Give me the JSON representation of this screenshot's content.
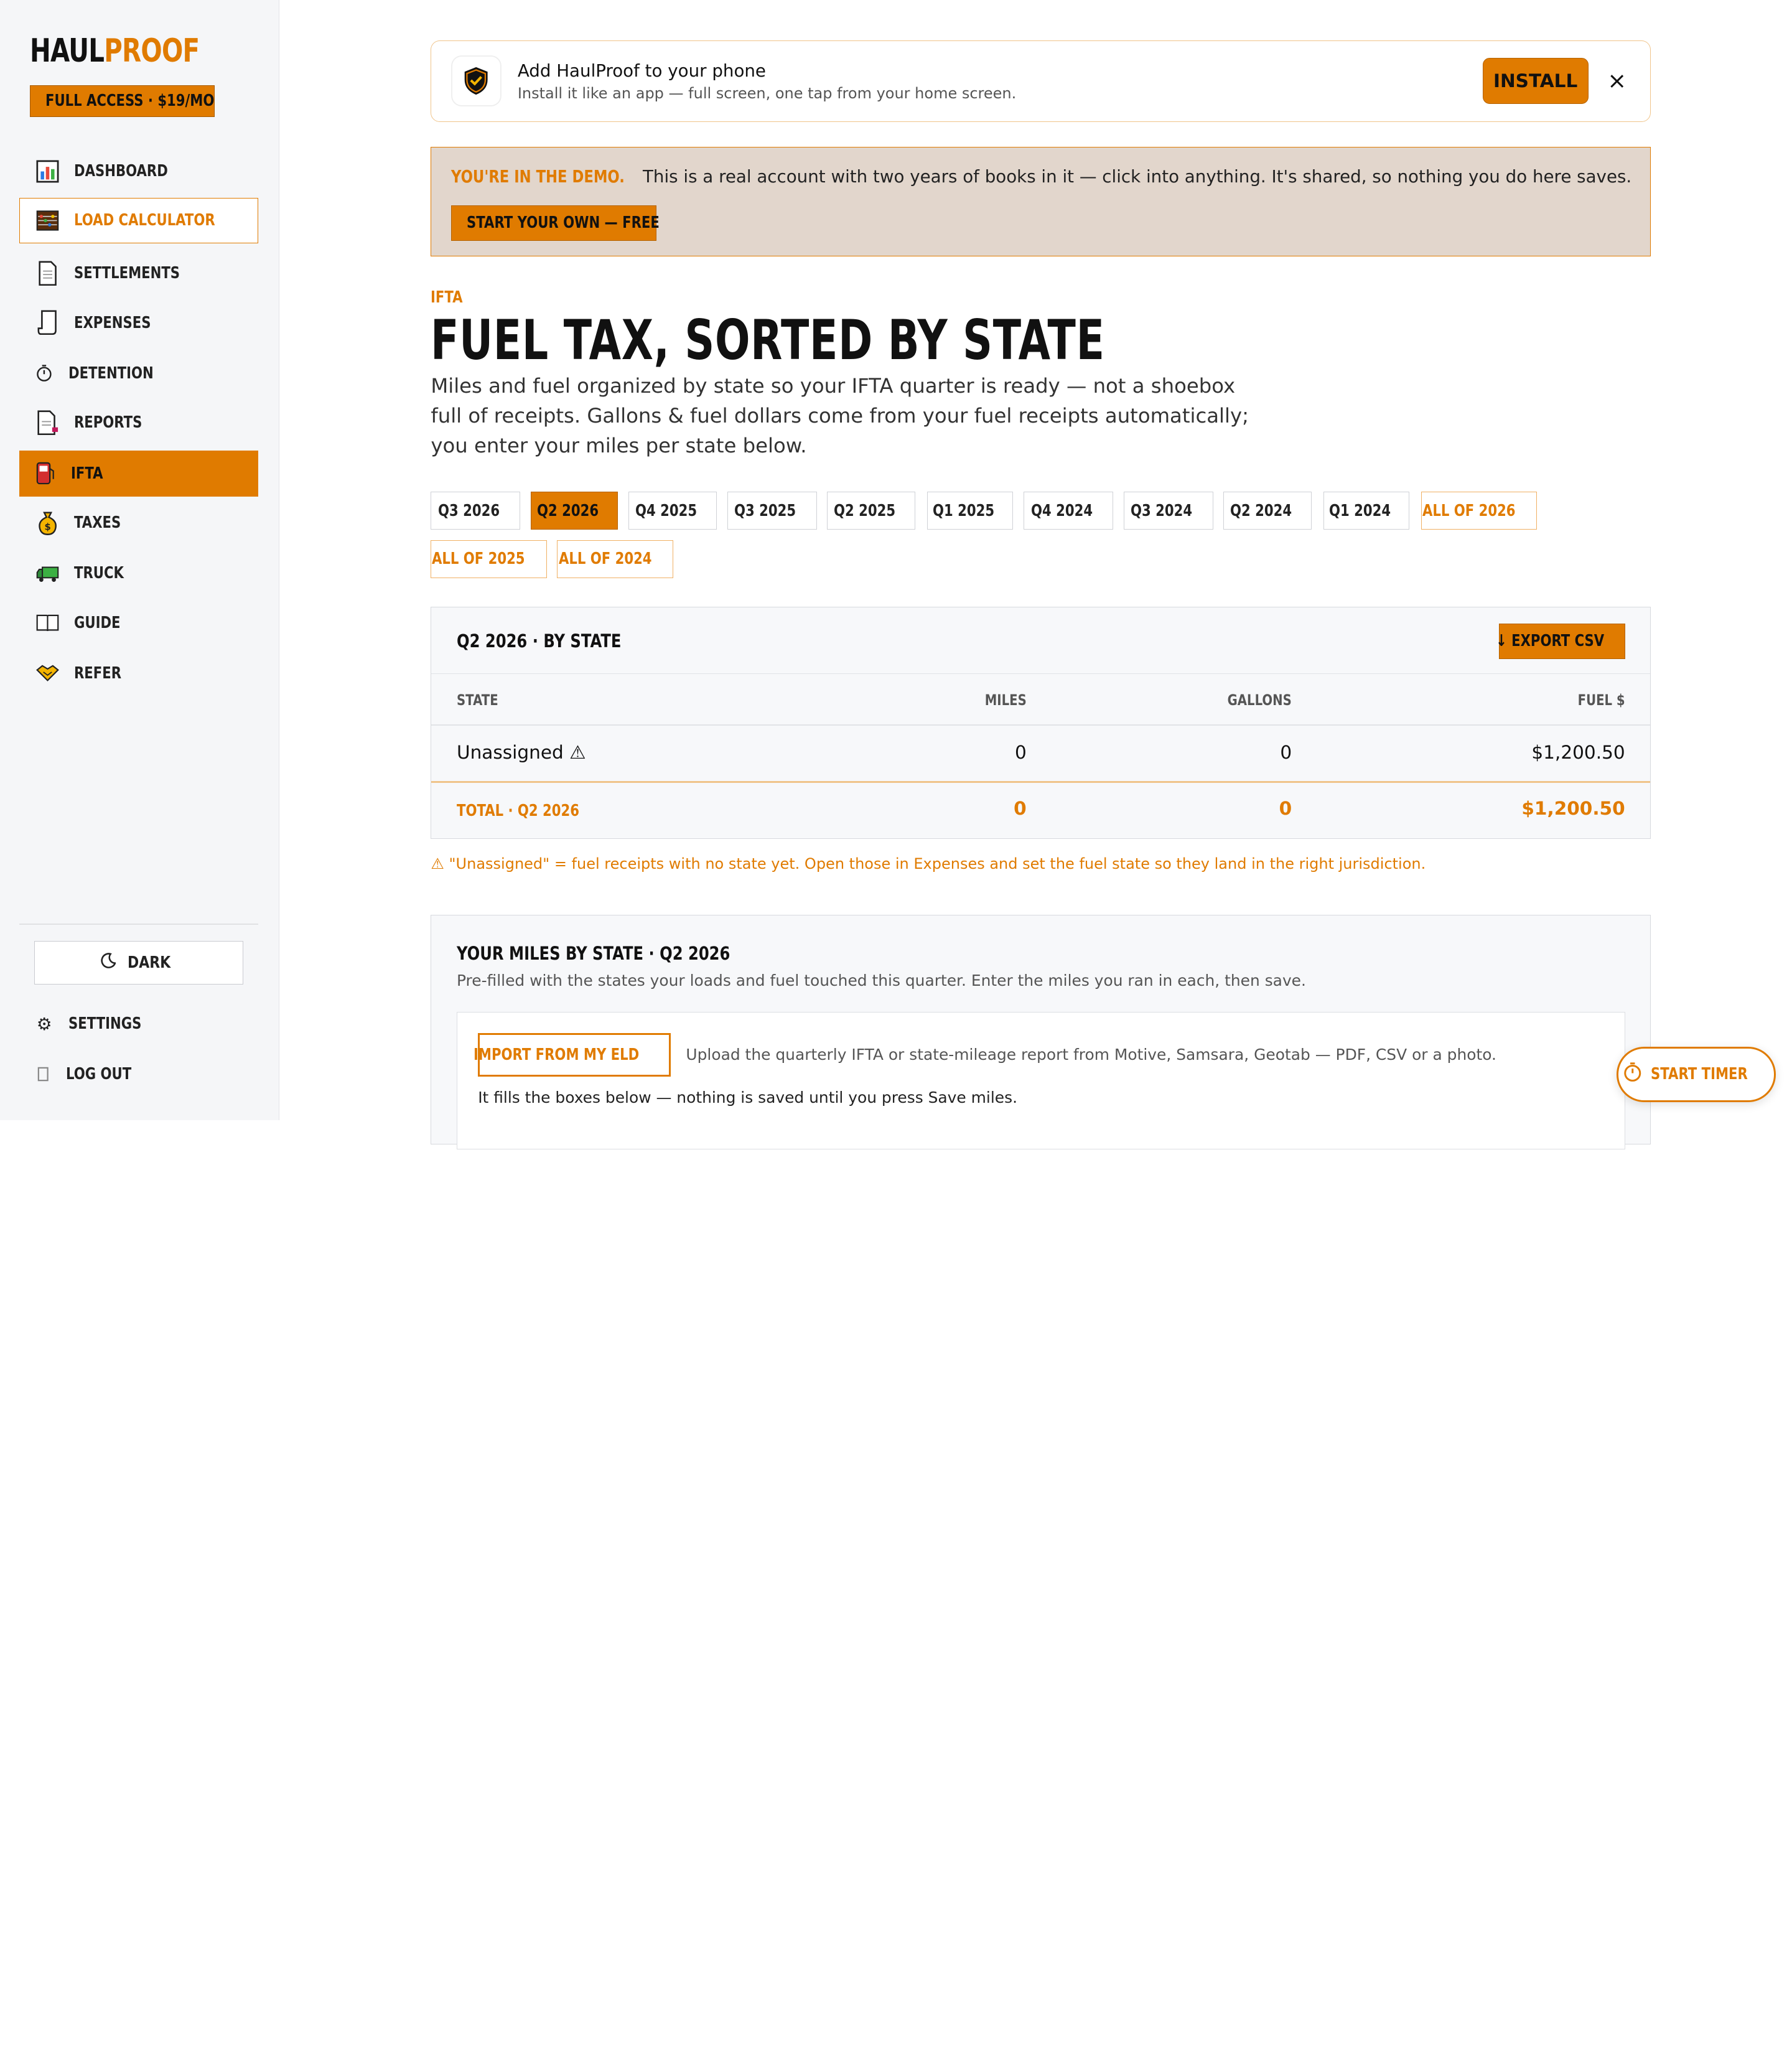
{
  "brand": {
    "part1": "HAUL",
    "part2": "PROOF"
  },
  "access_badge": "FULL ACCESS · $19/MO",
  "nav": {
    "items": [
      {
        "label": "DASHBOARD",
        "icon": "bar-chart-icon"
      },
      {
        "label": "LOAD CALCULATOR",
        "icon": "abacus-icon"
      },
      {
        "label": "SETTLEMENTS",
        "icon": "document-icon"
      },
      {
        "label": "EXPENSES",
        "icon": "receipt-icon"
      },
      {
        "label": "DETENTION",
        "icon": "stopwatch-icon"
      },
      {
        "label": "REPORTS",
        "icon": "report-icon"
      },
      {
        "label": "IFTA",
        "icon": "fuel-pump-icon"
      },
      {
        "label": "TAXES",
        "icon": "money-bag-icon"
      },
      {
        "label": "TRUCK",
        "icon": "truck-icon"
      },
      {
        "label": "GUIDE",
        "icon": "book-icon"
      },
      {
        "label": "REFER",
        "icon": "handshake-icon"
      }
    ],
    "dark_label": "DARK",
    "settings_label": "SETTINGS",
    "logout_label": "LOG OUT"
  },
  "install": {
    "title": "Add HaulProof to your phone",
    "subtitle": "Install it like an app — full screen, one tap from your home screen.",
    "button": "INSTALL",
    "close": "×"
  },
  "demo": {
    "lead": "YOU'RE IN THE DEMO.",
    "text": "This is a real account with two years of books in it — click into anything. It's shared, so nothing you do here saves.",
    "button": "START YOUR OWN — FREE"
  },
  "page": {
    "eyebrow": "IFTA",
    "title": "FUEL TAX, SORTED BY STATE",
    "description": "Miles and fuel organized by state so your IFTA quarter is ready — not a shoebox full of receipts. Gallons & fuel dollars come from your fuel receipts automatically; you enter your miles per state below."
  },
  "periods": [
    "Q3 2026",
    "Q2 2026",
    "Q4 2025",
    "Q3 2025",
    "Q2 2025",
    "Q1 2025",
    "Q4 2024",
    "Q3 2024",
    "Q2 2024",
    "Q1 2024",
    "ALL OF 2026",
    "ALL OF 2025",
    "ALL OF 2024"
  ],
  "selected_period": "Q2 2026",
  "table": {
    "title": "Q2 2026 · BY STATE",
    "export_label": "↓ EXPORT CSV",
    "headers": {
      "state": "STATE",
      "miles": "MILES",
      "gallons": "GALLONS",
      "fuel": "FUEL $"
    },
    "rows": [
      {
        "state": "Unassigned ⚠",
        "miles": "0",
        "gallons": "0",
        "fuel": "$1,200.50"
      }
    ],
    "total": {
      "label": "TOTAL · Q2 2026",
      "miles": "0",
      "gallons": "0",
      "fuel": "$1,200.50"
    }
  },
  "unassigned_note": "⚠ \"Unassigned\" = fuel receipts with no state yet. Open those in Expenses and set the fuel state so they land in the right jurisdiction.",
  "miles": {
    "title": "YOUR MILES BY STATE · Q2 2026",
    "subtitle": "Pre-filled with the states your loads and fuel touched this quarter. Enter the miles you ran in each, then save.",
    "eld_button": "IMPORT FROM MY ELD",
    "eld_description": "Upload the quarterly IFTA or state-mileage report from Motive, Samsara, Geotab — PDF, CSV or a photo.",
    "eld_note": "It fills the boxes below — nothing is saved until you press Save miles."
  },
  "timer_label": "START TIMER",
  "colors": {
    "accent": "#e07b00",
    "demo_bg": "#e2d6cc"
  }
}
